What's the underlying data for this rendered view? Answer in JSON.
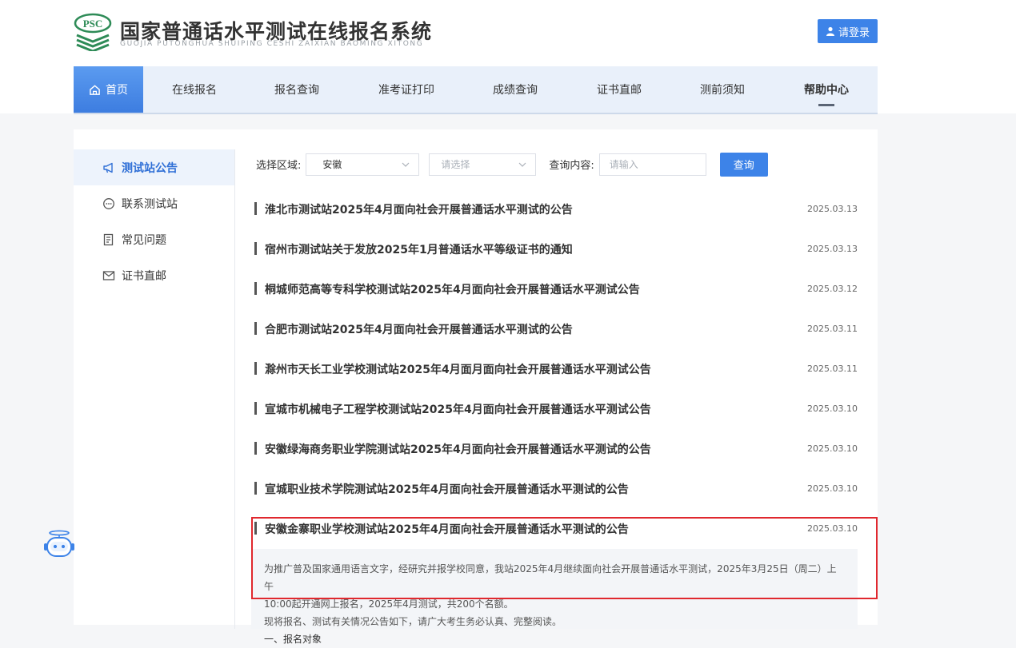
{
  "header": {
    "logo_text": "PSC",
    "title": "国家普通话水平测试在线报名系统",
    "subtitle": "GUOJIA PUTONGHUA SHUIPING CESHI ZAIXIAN BAOMING XITONG",
    "login_label": "请登录"
  },
  "nav": {
    "items": [
      "首页",
      "在线报名",
      "报名查询",
      "准考证打印",
      "成绩查询",
      "证书直邮",
      "测前须知",
      "帮助中心"
    ],
    "active": "帮助中心"
  },
  "sidebar": {
    "items": [
      "测试站公告",
      "联系测试站",
      "常见问题",
      "证书直邮"
    ]
  },
  "filter": {
    "region_label": "选择区域:",
    "region_value": "安徽",
    "city_placeholder": "请选择",
    "content_label": "查询内容:",
    "content_placeholder": "请输入",
    "query_label": "查询"
  },
  "announcements": [
    {
      "title": "淮北市测试站2025年4月面向社会开展普通话水平测试的公告",
      "date": "2025.03.13"
    },
    {
      "title": "宿州市测试站关于发放2025年1月普通话水平等级证书的通知",
      "date": "2025.03.13"
    },
    {
      "title": "桐城师范高等专科学校测试站2025年4月面向社会开展普通话水平测试公告",
      "date": "2025.03.12"
    },
    {
      "title": "合肥市测试站2025年4月面向社会开展普通话水平测试的公告",
      "date": "2025.03.11"
    },
    {
      "title": "滁州市天长工业学校测试站2025年4月面月面向社会开展普通话水平测试公告",
      "date": "2025.03.11"
    },
    {
      "title": "宣城市机械电子工程学校测试站2025年4月面向社会开展普通话水平测试公告",
      "date": "2025.03.10"
    },
    {
      "title": "安徽绿海商务职业学院测试站2025年4月面向社会开展普通话水平测试的公告",
      "date": "2025.03.10"
    },
    {
      "title": "宣城职业技术学院测试站2025年4月面向社会开展普通话水平测试的公告",
      "date": "2025.03.10"
    },
    {
      "title": "安徽金寨职业学校测试站2025年4月面向社会开展普通话水平测试的公告",
      "date": "2025.03.10"
    }
  ],
  "detail": {
    "line1": "为推广普及国家通用语言文字，经研究并报学校同意，我站2025年4月继续面向社会开展普通话水平测试，2025年3月25日（周二）上午",
    "line2": "10:00起开通网上报名，2025年4月测试，共200个名额。",
    "line3": "现将报名、测试有关情况公告如下，请广大考生务必认真、完整阅读。",
    "line4": "一、报名对象"
  },
  "colors": {
    "accent": "#3d83e8",
    "nav_bg": "#e9f0fa",
    "highlight_border": "#e0282e"
  },
  "icons": {
    "login": "user-icon",
    "home": "home-icon",
    "sidebar": [
      "megaphone-icon",
      "chat-bubble-icon",
      "document-icon",
      "envelope-icon"
    ],
    "robot": "robot-assistant-icon"
  }
}
